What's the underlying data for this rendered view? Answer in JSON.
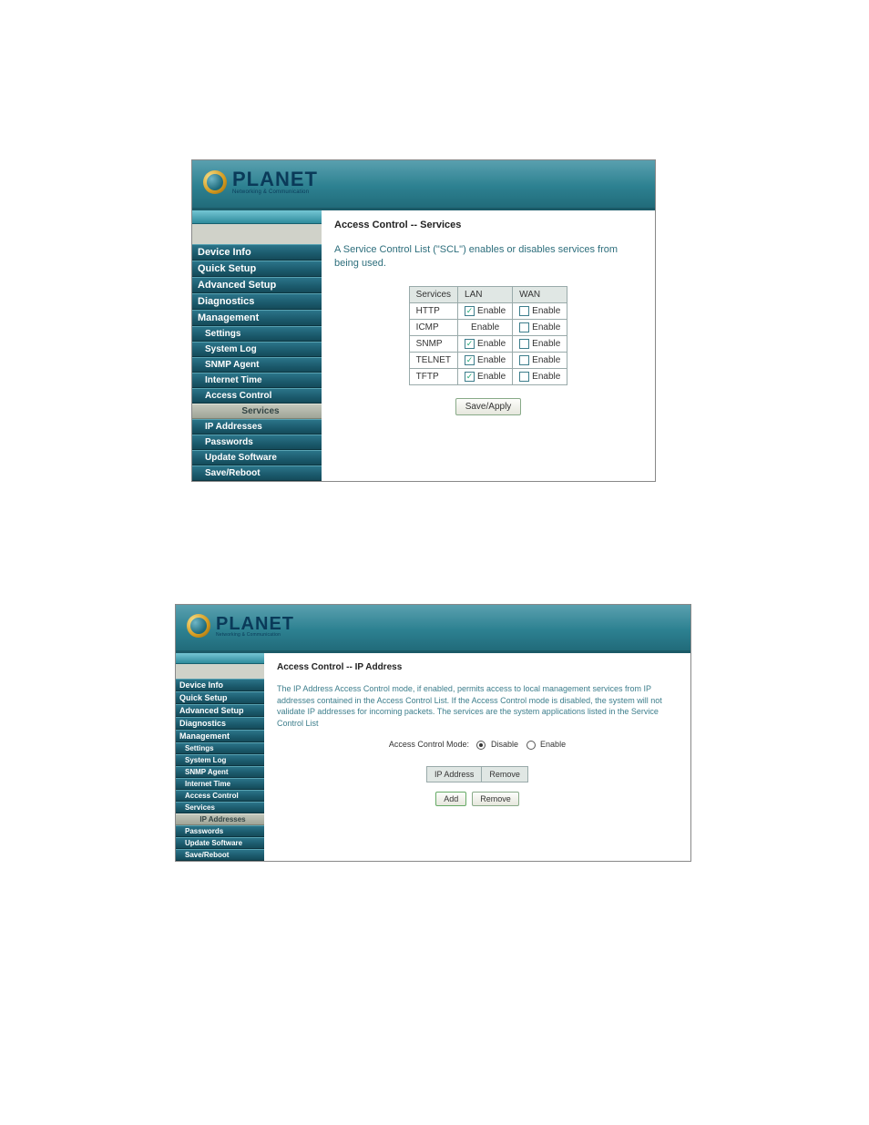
{
  "logo": {
    "brand": "PLANET",
    "tagline": "Networking & Communication"
  },
  "shot1": {
    "nav": [
      {
        "label": "Device Info",
        "sub": false,
        "active": false
      },
      {
        "label": "Quick Setup",
        "sub": false,
        "active": false
      },
      {
        "label": "Advanced Setup",
        "sub": false,
        "active": false
      },
      {
        "label": "Diagnostics",
        "sub": false,
        "active": false
      },
      {
        "label": "Management",
        "sub": false,
        "active": false
      },
      {
        "label": "Settings",
        "sub": true,
        "active": false
      },
      {
        "label": "System Log",
        "sub": true,
        "active": false
      },
      {
        "label": "SNMP Agent",
        "sub": true,
        "active": false
      },
      {
        "label": "Internet Time",
        "sub": true,
        "active": false
      },
      {
        "label": "Access Control",
        "sub": true,
        "active": false
      },
      {
        "label": "Services",
        "sub": true,
        "active": true
      },
      {
        "label": "IP Addresses",
        "sub": true,
        "active": false
      },
      {
        "label": "Passwords",
        "sub": true,
        "active": false
      },
      {
        "label": "Update Software",
        "sub": true,
        "active": false
      },
      {
        "label": "Save/Reboot",
        "sub": true,
        "active": false
      }
    ],
    "title": "Access Control -- Services",
    "desc": "A Service Control List (\"SCL\") enables or disables services from being used.",
    "table": {
      "headers": [
        "Services",
        "LAN",
        "WAN"
      ],
      "rows": [
        {
          "svc": "HTTP",
          "lan_chk": true,
          "lan_label": "Enable",
          "wan_chk": false,
          "wan_label": "Enable",
          "lan_has_chk": true
        },
        {
          "svc": "ICMP",
          "lan_chk": false,
          "lan_label": "Enable",
          "wan_chk": false,
          "wan_label": "Enable",
          "lan_has_chk": false
        },
        {
          "svc": "SNMP",
          "lan_chk": true,
          "lan_label": "Enable",
          "wan_chk": false,
          "wan_label": "Enable",
          "lan_has_chk": true
        },
        {
          "svc": "TELNET",
          "lan_chk": true,
          "lan_label": "Enable",
          "wan_chk": false,
          "wan_label": "Enable",
          "lan_has_chk": true
        },
        {
          "svc": "TFTP",
          "lan_chk": true,
          "lan_label": "Enable",
          "wan_chk": false,
          "wan_label": "Enable",
          "lan_has_chk": true
        }
      ]
    },
    "save_label": "Save/Apply"
  },
  "shot2": {
    "nav": [
      {
        "label": "Device Info",
        "sub": false,
        "active": false
      },
      {
        "label": "Quick Setup",
        "sub": false,
        "active": false
      },
      {
        "label": "Advanced Setup",
        "sub": false,
        "active": false
      },
      {
        "label": "Diagnostics",
        "sub": false,
        "active": false
      },
      {
        "label": "Management",
        "sub": false,
        "active": false
      },
      {
        "label": "Settings",
        "sub": true,
        "active": false
      },
      {
        "label": "System Log",
        "sub": true,
        "active": false
      },
      {
        "label": "SNMP Agent",
        "sub": true,
        "active": false
      },
      {
        "label": "Internet Time",
        "sub": true,
        "active": false
      },
      {
        "label": "Access Control",
        "sub": true,
        "active": false
      },
      {
        "label": "Services",
        "sub": true,
        "active": false
      },
      {
        "label": "IP Addresses",
        "sub": true,
        "active": true
      },
      {
        "label": "Passwords",
        "sub": true,
        "active": false
      },
      {
        "label": "Update Software",
        "sub": true,
        "active": false
      },
      {
        "label": "Save/Reboot",
        "sub": true,
        "active": false
      }
    ],
    "title": "Access Control -- IP Address",
    "desc": "The IP Address Access Control mode, if enabled, permits access to local management services from IP addresses contained in the Access Control List. If the Access Control mode is disabled, the system will not validate IP addresses for incoming packets. The services are the system applications listed in the Service Control List",
    "mode_label": "Access Control Mode:",
    "disable_label": "Disable",
    "enable_label": "Enable",
    "mode_selected": "disable",
    "ip_headers": [
      "IP Address",
      "Remove"
    ],
    "add_label": "Add",
    "remove_label": "Remove"
  }
}
